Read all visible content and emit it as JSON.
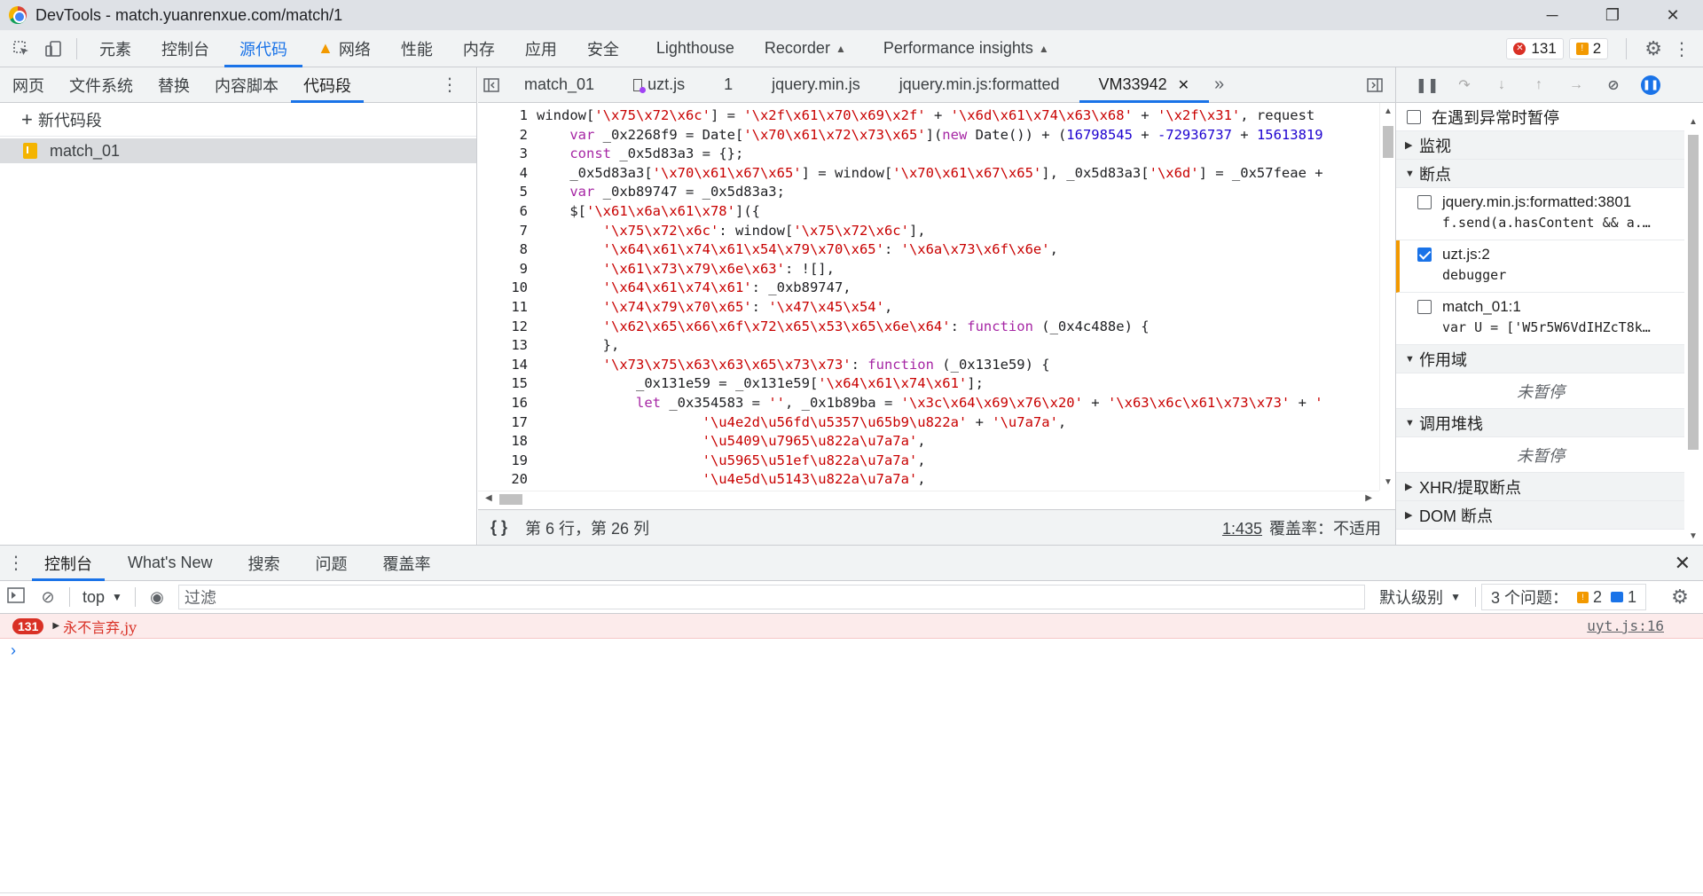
{
  "window": {
    "title": "DevTools - match.yuanrenxue.com/match/1"
  },
  "main_tabs": [
    "元素",
    "控制台",
    "源代码",
    "网络",
    "性能",
    "内存",
    "应用",
    "安全",
    "Lighthouse",
    "Recorder",
    "Performance insights"
  ],
  "main_active": "源代码",
  "badges": {
    "errors": "131",
    "warnings": "2"
  },
  "navigator": {
    "tabs": [
      "网页",
      "文件系统",
      "替换",
      "内容脚本",
      "代码段"
    ],
    "active": "代码段",
    "new_snippet": "新代码段",
    "snippet_item": "match_01"
  },
  "editor": {
    "tabs": [
      "match_01",
      "uzt.js",
      "1",
      "jquery.min.js",
      "jquery.min.js:formatted",
      "VM33942"
    ],
    "active": "VM33942",
    "status_position": "第 6 行，第 26 列",
    "status_ref": "1:435",
    "status_coverage": "覆盖率：不适用",
    "line_numbers": [
      "1",
      "2",
      "3",
      "4",
      "5",
      "6",
      "7",
      "8",
      "9",
      "10",
      "11",
      "12",
      "13",
      "14",
      "15",
      "16",
      "17",
      "18",
      "19",
      "20"
    ]
  },
  "debugger": {
    "pause_on_exceptions": "在遇到异常时暂停",
    "sections": {
      "watch": "监视",
      "breakpoints": "断点",
      "scope": "作用域",
      "callstack": "调用堆栈",
      "xhr": "XHR/提取断点",
      "dom": "DOM 断点"
    },
    "not_paused": "未暂停",
    "breakpoints": [
      {
        "file": "jquery.min.js:formatted:3801",
        "code": "f.send(a.hasContent && a.…",
        "checked": false
      },
      {
        "file": "uzt.js:2",
        "code": "debugger",
        "checked": true
      },
      {
        "file": "match_01:1",
        "code": "var U = ['W5r5W6VdIHZcT8k…",
        "checked": false
      }
    ]
  },
  "drawer": {
    "tabs": [
      "控制台",
      "What's New",
      "搜索",
      "问题",
      "覆盖率"
    ],
    "active": "控制台",
    "context": "top",
    "filter_placeholder": "过滤",
    "levels": "默认级别",
    "issues_label": "3 个问题：",
    "issues_warn": "2",
    "issues_info": "1",
    "message": {
      "count": "131",
      "text": "永不言弃,jy",
      "source": "uyt.js:16"
    }
  }
}
